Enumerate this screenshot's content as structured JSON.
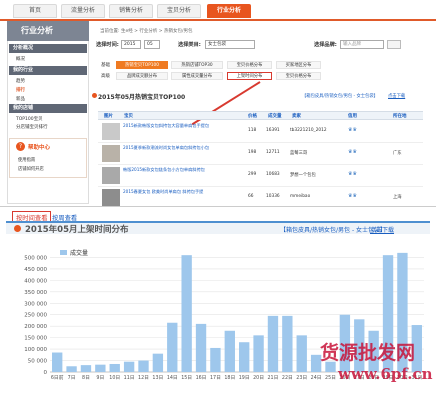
{
  "topnav": {
    "tabs": [
      "首页",
      "流量分析",
      "销售分析",
      "宝贝分析",
      "行业分析"
    ],
    "active": 4
  },
  "sidebar": {
    "brand": "行业分析",
    "sections": [
      {
        "heading": "分析概况",
        "items": [
          "概况"
        ]
      },
      {
        "heading": "我的行业",
        "items": [
          "趋势",
          "排行",
          "新品"
        ]
      },
      {
        "heading": "我的店铺",
        "items": [
          "TOP100宝贝",
          "分店铺宝贝排行"
        ]
      }
    ],
    "help": {
      "title": "帮助中心",
      "items": [
        "使用指南",
        "店铺如何开店"
      ]
    }
  },
  "breadcrumb": "当前位置: 生e经 > 行业分析 > 热销女包/男包",
  "filters": {
    "period_label": "选择时间:",
    "year": "2015",
    "month": "05",
    "category_label": "选择类目:",
    "category": "女士包袋",
    "brand_label": "选择品牌:",
    "brand_placeholder": "输入品牌"
  },
  "subtabs": {
    "row1_label": "基础",
    "row1": [
      "热销宝贝TOP100",
      "热销店铺TOP30",
      "宝贝价格分布",
      "买家地区分布"
    ],
    "row2_label": "高级",
    "row2": [
      "品牌成交额分布",
      "属性成交量分布",
      "上架时间分布",
      "宝贝价格分布"
    ]
  },
  "section": {
    "title": "2015年05月热销宝贝TOP100",
    "tag": "【箱包皮具/热销女包/男包 - 女士包袋】",
    "link": "点击下载"
  },
  "table": {
    "headers": [
      "图片",
      "宝贝",
      "价格",
      "成交量",
      "卖家",
      "信用",
      "所在地"
    ],
    "rows": [
      {
        "title": "2015新款韩版女包斜挎包大容量单肩包手提包",
        "price": "118",
        "sales": "16391",
        "seller": "tb3221210_2012",
        "loc": ""
      },
      {
        "title": "2015夏季新款潮流时尚女包单肩包斜挎包小包",
        "price": "198",
        "sales": "12711",
        "seller": "蓝莓三哥",
        "loc": "广东"
      },
      {
        "title": "韩版2015新款女包链条包小方包单肩斜挎包",
        "price": "299",
        "sales": "10683",
        "seller": "梦想一个包包",
        "loc": ""
      },
      {
        "title": "2015春夏女包 欧美时尚单肩包 斜挎包手提",
        "price": "66",
        "sales": "10336",
        "seller": "mmeibao",
        "loc": "上海"
      }
    ]
  },
  "bottom": {
    "view_a": "按时间查看",
    "view_b": "按周查看",
    "chart_title": "2015年05月上架时间分布",
    "chart_tag": "【箱包皮具/热销女包/男包 - 女士包袋】",
    "chart_link": "点击下载"
  },
  "watermark": {
    "line1": "货源批发网",
    "line2": "www.6pf.cn"
  },
  "chart_data": {
    "type": "bar",
    "legend": "成交量",
    "legend_position": "top-left",
    "ylim": [
      0,
      550000
    ],
    "yticks": [
      0,
      50000,
      100000,
      150000,
      200000,
      250000,
      300000,
      350000,
      400000,
      450000,
      500000
    ],
    "ytick_labels": [
      "0",
      "50 000",
      "100 000",
      "150 000",
      "200 000",
      "250 000",
      "300 000",
      "350 000",
      "400 000",
      "450 000",
      "500 000"
    ],
    "categories": [
      "6日前",
      "7日",
      "8日",
      "9日",
      "10日",
      "11日",
      "12日",
      "13日",
      "14日",
      "15日",
      "16日",
      "17日",
      "18日",
      "19日",
      "20日",
      "21日",
      "22日",
      "23日",
      "24日",
      "25日",
      "26日",
      "27日",
      "28日",
      "29日",
      "30日",
      "31日"
    ],
    "values": [
      85000,
      25000,
      30000,
      32000,
      35000,
      45000,
      50000,
      80000,
      215000,
      510000,
      210000,
      105000,
      180000,
      130000,
      160000,
      245000,
      245000,
      160000,
      75000,
      45000,
      250000,
      230000,
      180000,
      510000,
      520000,
      205000
    ],
    "color": "#9ec7ec",
    "grid": true
  },
  "colors": {
    "accent": "#e8551f",
    "link": "#1a5ec0",
    "highlight_box": "#d83a30",
    "bar": "#9ec7ec"
  }
}
